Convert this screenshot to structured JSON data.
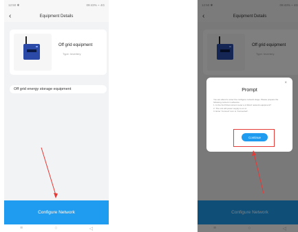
{
  "colors": {
    "primary": "#1f9cef",
    "highlight": "#e53935"
  },
  "left": {
    "status": {
      "time": "12:50 ✱",
      "right": "09:43% ⌁ 4G"
    },
    "nav": {
      "back_icon": "‹",
      "title": "Equipment Details"
    },
    "equipment": {
      "name": "Off grid equipment",
      "sub": "Type: Invertery"
    },
    "type_label": "Off grid energy storage equipment",
    "configure_button": "Configure Network",
    "bottom_nav": [
      "≡",
      "○",
      "◁"
    ]
  },
  "right": {
    "status": {
      "time": "12:50 ✱",
      "right": "09:43% ⌁ 4G"
    },
    "nav": {
      "back_icon": "‹",
      "title": "Equipment Details"
    },
    "equipment": {
      "name": "Off grid equipment",
      "sub": "Type: Invertery"
    },
    "dialog": {
      "title": "Prompt",
      "close_icon": "×",
      "body": "You are about to enter the configure network stage. Please prepare the following content in advance:\n1. Is the No.8 that current router a 2.4GHz network equipment?\n2. The unit will power supply is on or.\n3. Enter 'Connect' icon to 'Connected'.",
      "button": "Continue"
    },
    "configure_button": "Configure Network",
    "bottom_nav": [
      "≡",
      "○",
      "◁"
    ]
  }
}
